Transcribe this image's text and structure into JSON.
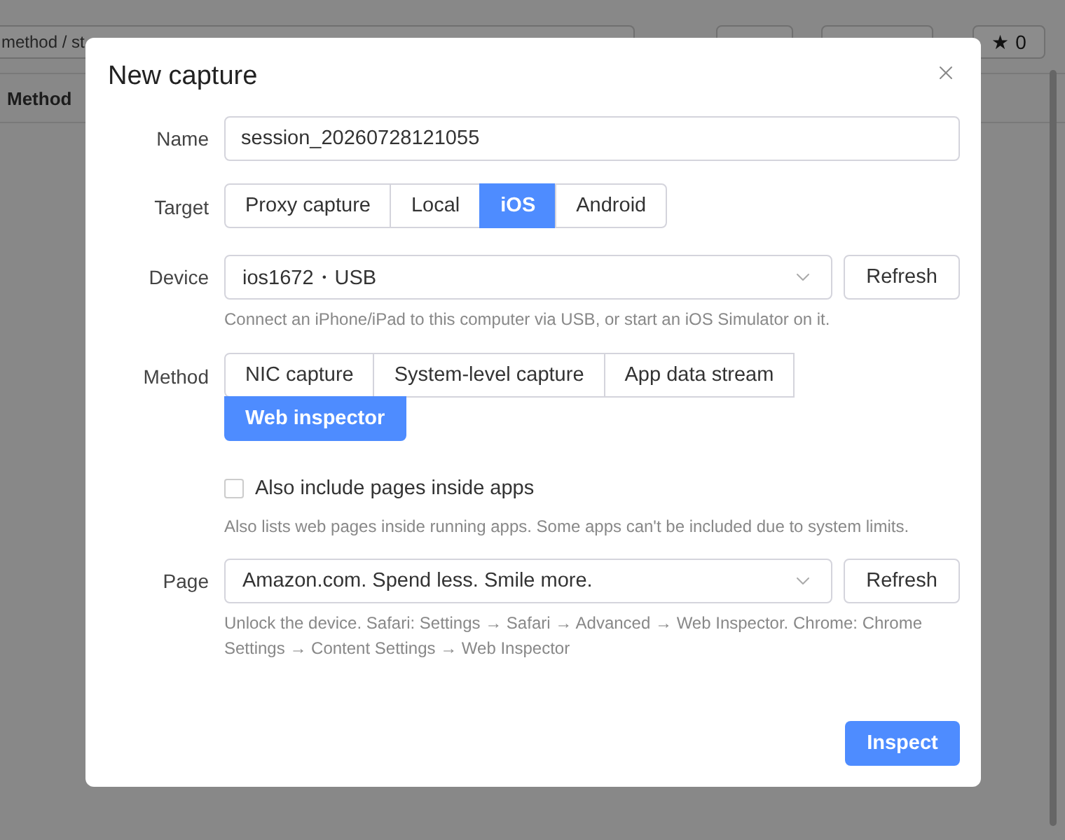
{
  "background": {
    "filter": {
      "value": "method / st"
    },
    "star_button": {
      "icon": "★",
      "count": "0"
    },
    "column_header": "Method"
  },
  "dialog": {
    "title": "New capture",
    "name": {
      "label": "Name",
      "value": "session_20260728121055"
    },
    "target": {
      "label": "Target",
      "options": [
        {
          "label": "Proxy capture",
          "selected": false
        },
        {
          "label": "Local",
          "selected": false
        },
        {
          "label": "iOS",
          "selected": true
        },
        {
          "label": "Android",
          "selected": false
        }
      ]
    },
    "device": {
      "label": "Device",
      "value": "ios1672・USB",
      "button": "Refresh",
      "hint": "Connect an iPhone/iPad to this computer via USB, or start an iOS Simulator on it."
    },
    "method": {
      "label": "Method",
      "options": [
        {
          "label": "NIC capture",
          "selected": false
        },
        {
          "label": "System-level capture",
          "selected": false
        },
        {
          "label": "App data stream",
          "selected": false
        },
        {
          "label": "Web inspector",
          "selected": true
        }
      ]
    },
    "include_apps": {
      "label": "Also include pages inside apps",
      "checked": false,
      "hint": "Also lists web pages inside running apps. Some apps can't be included due to system limits."
    },
    "page": {
      "label": "Page",
      "value": "Amazon.com. Spend less. Smile more.",
      "button": "Refresh",
      "hint": "Unlock the device. Safari: Settings → Safari → Advanced → Web Inspector. Chrome: Chrome Settings → Content Settings → Web Inspector"
    },
    "primary_button": "Inspect"
  }
}
